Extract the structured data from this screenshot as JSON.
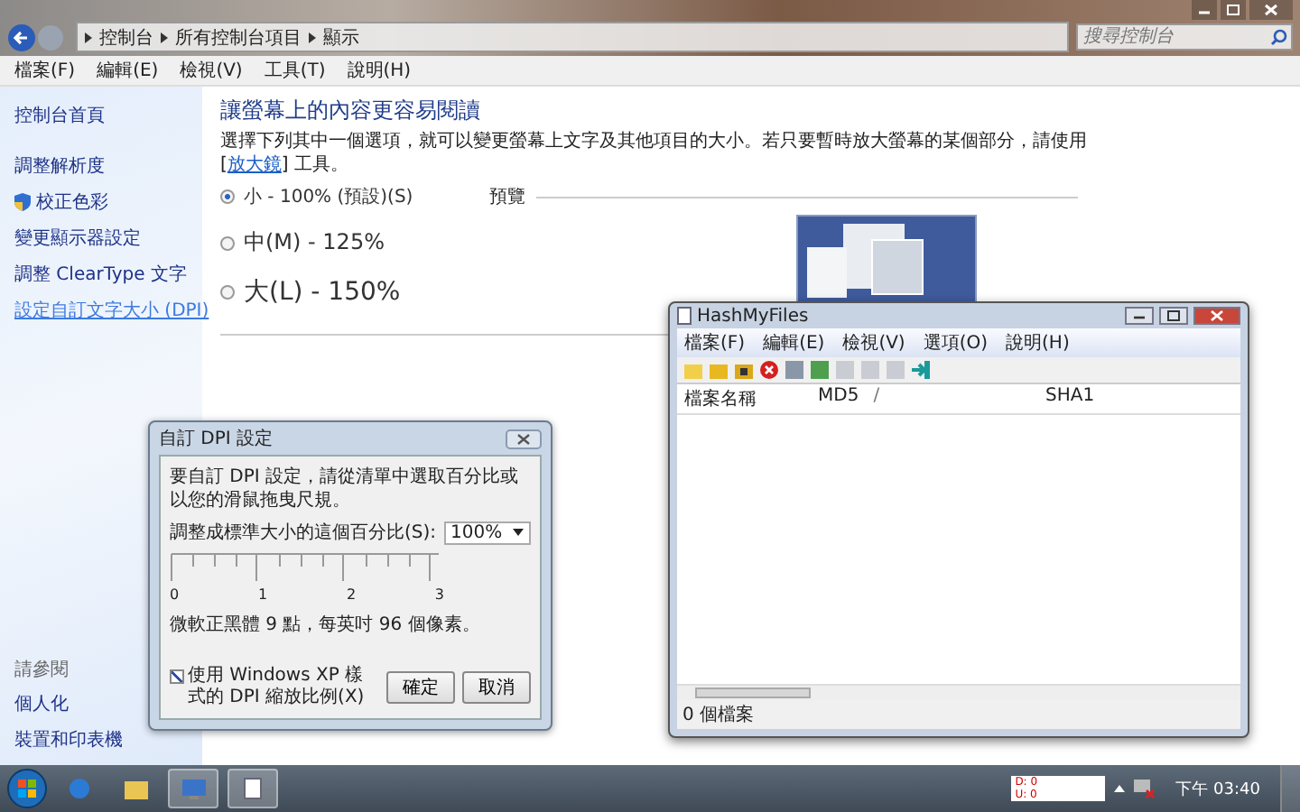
{
  "explorer": {
    "breadcrumb": [
      "控制台",
      "所有控制台項目",
      "顯示"
    ],
    "search": {
      "placeholder": "搜尋控制台"
    },
    "menu": [
      "檔案(F)",
      "編輯(E)",
      "檢視(V)",
      "工具(T)",
      "說明(H)"
    ],
    "sidebar": {
      "items": [
        {
          "label": "控制台首頁",
          "selected": false,
          "kind": "plain"
        },
        {
          "label": "調整解析度",
          "selected": false,
          "kind": "plain"
        },
        {
          "label": "校正色彩",
          "selected": false,
          "kind": "shield"
        },
        {
          "label": "變更顯示器設定",
          "selected": false,
          "kind": "plain"
        },
        {
          "label": "調整 ClearType 文字",
          "selected": false,
          "kind": "plain"
        },
        {
          "label": "設定自訂文字大小 (DPI)",
          "selected": true,
          "kind": "plain"
        }
      ],
      "see_also_title": "請參閱",
      "see_also": [
        "個人化",
        "裝置和印表機"
      ]
    },
    "heading": "讓螢幕上的內容更容易閱讀",
    "intro": "選擇下列其中一個選項，就可以變更螢幕上文字及其他項目的大小。若只要暫時放大螢幕的某個部分，請使用",
    "intro_open": "[",
    "intro_link": "放大鏡",
    "intro_end": "] 工具。",
    "options": [
      {
        "label": "小 - 100% (預設)(S)",
        "selected": true
      },
      {
        "label": "中(M) - 125%",
        "selected": false
      },
      {
        "label": "大(L) - 150%",
        "selected": false
      }
    ],
    "preview_label": "預覽"
  },
  "dpi_dialog": {
    "title": "自訂 DPI 設定",
    "instruction": "要自訂 DPI 設定，請從清單中選取百分比或以您的滑鼠拖曳尺規。",
    "scale_label": "調整成標準大小的這個百分比(S):",
    "scale_value": "100%",
    "ruler_labels": [
      "0",
      "1",
      "2",
      "3"
    ],
    "font_info": "微軟正黑體 9 點，每英吋 96 個像素。",
    "xp_scaling": {
      "label": "使用 Windows XP 樣式的 DPI 縮放比例(X)",
      "checked": true
    },
    "buttons": [
      "確定",
      "取消"
    ]
  },
  "hashmyfiles": {
    "title": "HashMyFiles",
    "menu": [
      "檔案(F)",
      "編輯(E)",
      "檢視(V)",
      "選項(O)",
      "說明(H)"
    ],
    "columns": [
      "檔案名稱",
      "MD5",
      "/",
      "SHA1"
    ],
    "status": "0 個檔案"
  },
  "taskbar": {
    "net_meter": [
      "D: 0",
      "U: 0"
    ],
    "clock": "下午 03:40"
  }
}
